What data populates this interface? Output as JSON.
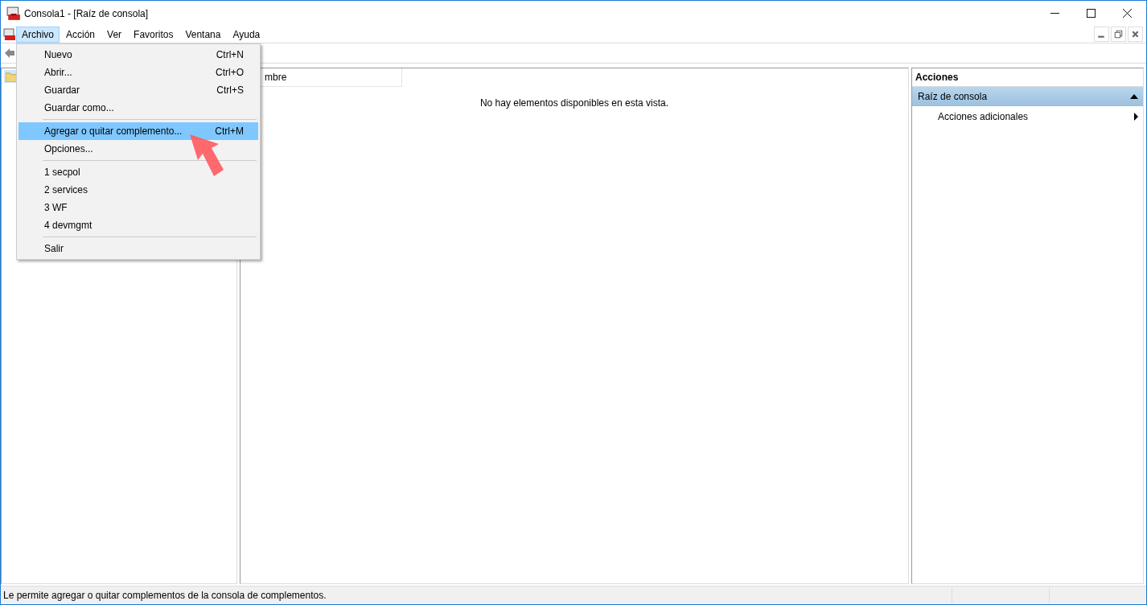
{
  "window": {
    "title": "Consola1 - [Raíz de consola]"
  },
  "menu_bar": [
    {
      "label": "Archivo",
      "selected": true
    },
    {
      "label": "Acción",
      "selected": false
    },
    {
      "label": "Ver",
      "selected": false
    },
    {
      "label": "Favoritos",
      "selected": false
    },
    {
      "label": "Ventana",
      "selected": false
    },
    {
      "label": "Ayuda",
      "selected": false
    }
  ],
  "file_menu": [
    [
      {
        "label": "Nuevo",
        "shortcut": "Ctrl+N",
        "selected": false
      },
      {
        "label": "Abrir...",
        "shortcut": "Ctrl+O",
        "selected": false
      },
      {
        "label": "Guardar",
        "shortcut": "Ctrl+S",
        "selected": false
      },
      {
        "label": "Guardar como...",
        "selected": false
      }
    ],
    [
      {
        "label": "Agregar o quitar complemento...",
        "shortcut": "Ctrl+M",
        "selected": true
      },
      {
        "label": "Opciones...",
        "selected": false
      }
    ],
    [
      {
        "label": "1 secpol",
        "selected": false
      },
      {
        "label": "2 services",
        "selected": false
      },
      {
        "label": "3 WF",
        "selected": false
      },
      {
        "label": "4 devmgmt",
        "selected": false
      }
    ],
    [
      {
        "label": "Salir",
        "selected": false
      }
    ]
  ],
  "list": {
    "column_1": "mbre",
    "empty_message": "No hay elementos disponibles en esta vista."
  },
  "actions": {
    "header": "Acciones",
    "section": {
      "label": "Raíz de consola",
      "expanded": true
    },
    "items": [
      {
        "label": "Acciones adicionales"
      }
    ]
  },
  "status_bar": {
    "text": "Le permite agregar o quitar complementos de la consola de complementos."
  }
}
